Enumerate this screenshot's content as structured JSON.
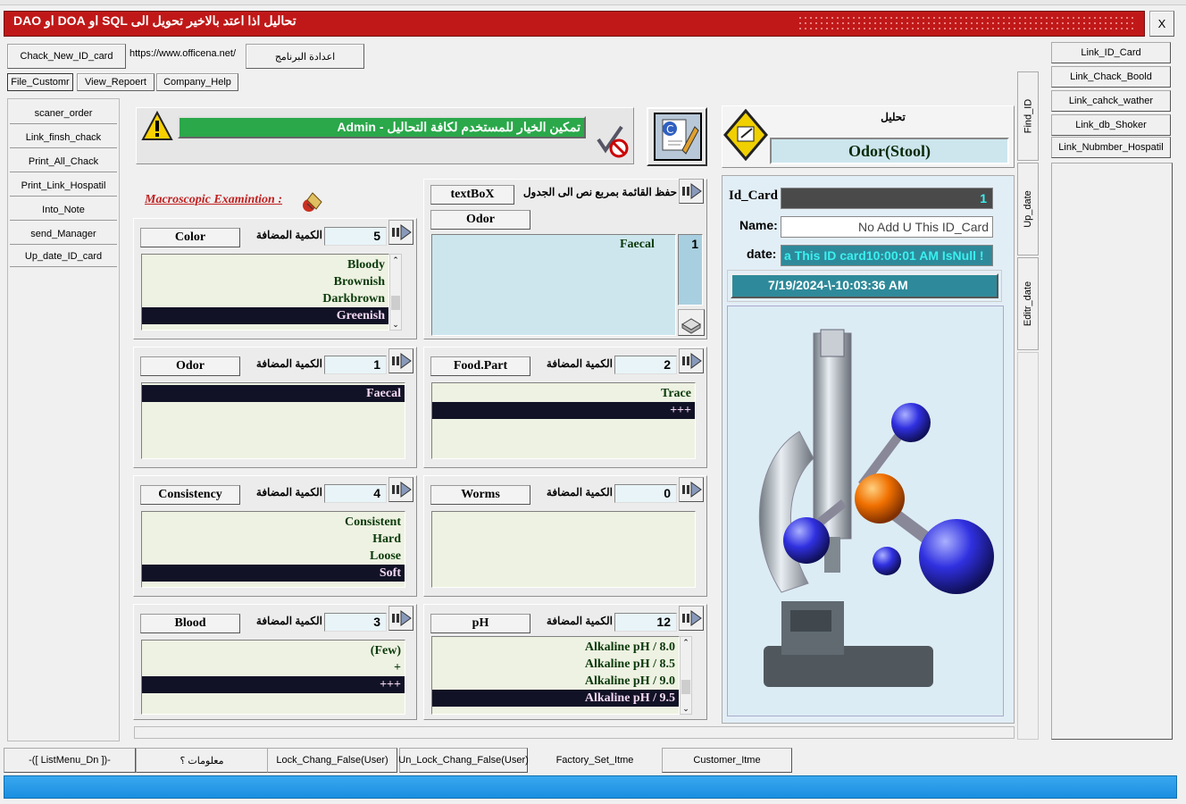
{
  "title_bar": {
    "title": "تحاليل اذا اعتد بالاخير تحويل الى SQL او DOA او DAO",
    "close_label": "X"
  },
  "toolbar": {
    "check_new_id_card": "Chack_New_ID_card",
    "url": "https://www.officena.net/",
    "settings": "اعدادة البرنامج"
  },
  "menu": {
    "file_customer": "File_Customr",
    "view_report": "View_Repoert",
    "company_help": "Company_Help"
  },
  "left_nav": [
    "scaner_order",
    "Link_finsh_chack",
    "Print_All_Chack",
    "Print_Link_Hospatil",
    "Into_Note",
    "send_Manager",
    "Up_date_ID_card"
  ],
  "right_links": [
    "Link_ID_Card",
    "Link_Chack_Boold",
    "Link_cahck_wather",
    "Link_db_Shoker",
    "Link_Nubmber_Hospatil"
  ],
  "vertical_tabs": [
    "Find_ID",
    "Up_date",
    "Editr_date"
  ],
  "banner": {
    "message": "تمكين الخيار للمستخدم لكافة التحاليل - Admin"
  },
  "analysis": {
    "label": "تحليل",
    "value": "Odor(Stool)"
  },
  "macroscopic_title": "Macroscopic Examintion :",
  "qty_label": "الكمية المضافة",
  "sections": {
    "color": {
      "label": "Color",
      "qty": "5",
      "items": [
        "Bloody",
        "Brownish",
        "Darkbrown",
        "Greenish"
      ],
      "selected": "Greenish"
    },
    "odor": {
      "label": "Odor",
      "qty": "1",
      "items": [
        "Faecal"
      ],
      "selected": "Faecal"
    },
    "consistency": {
      "label": "Consistency",
      "qty": "4",
      "items": [
        "Consistent",
        "Hard",
        "Loose",
        "Soft"
      ],
      "selected": "Soft"
    },
    "blood": {
      "label": "Blood",
      "qty": "3",
      "items": [
        "(Few)",
        "+",
        "+++"
      ],
      "selected": "+++"
    },
    "food_part": {
      "label": "Food.Part",
      "qty": "2",
      "items": [
        "Trace",
        "+++"
      ],
      "selected": "+++"
    },
    "worms": {
      "label": "Worms",
      "qty": "0",
      "items": []
    },
    "ph": {
      "label": "pH",
      "qty": "12",
      "items": [
        "Alkaline pH / 8.0",
        "Alkaline pH / 8.5",
        "Alkaline pH / 9.0",
        "Alkaline pH / 9.5"
      ],
      "selected": "Alkaline pH / 9.5"
    }
  },
  "textbox": {
    "label": "textBoX",
    "save_caption": "حفظ القائمة بمربع نص الى الجدول",
    "odor_label": "Odor",
    "content": "Faecal",
    "count": "1"
  },
  "card": {
    "id_label": "Id_Card",
    "id_value": "1",
    "name_label": "Name:",
    "name_value": "No Add U This ID_Card",
    "date_label": "date:",
    "date_value": "a This ID card10:00:01 AM IsNull !",
    "timestamp": "7/19/2024-\\-10:03:36 AM"
  },
  "bottom_buttons": [
    "-([ ListMenu_Dn ])-",
    "معلومات ؟",
    "Lock_Chang_False(User)",
    "Un_Lock_Chang_False(User)",
    "Factory_Set_Itme",
    "Customer_Itme"
  ],
  "colors": {
    "title_red": "#c01818",
    "banner_green": "#2aa84a",
    "status_blue": "#1a8ee0",
    "selected_row": "#121226",
    "card_teal": "#2e8a9a"
  }
}
